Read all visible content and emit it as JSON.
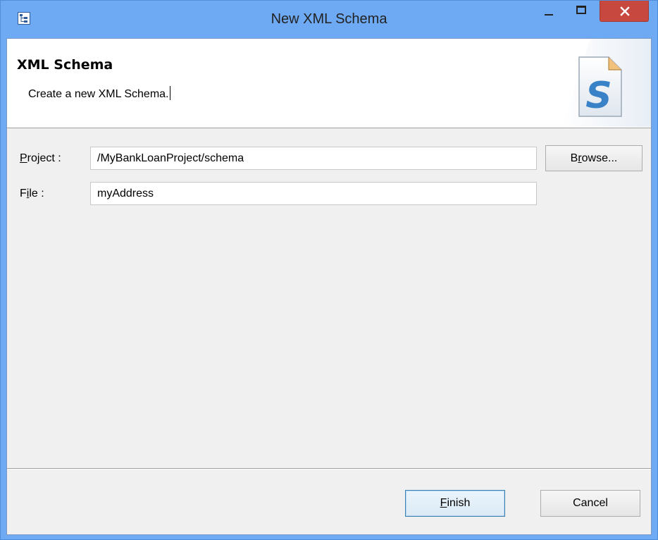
{
  "window": {
    "title": "New XML Schema"
  },
  "banner": {
    "title": "XML Schema",
    "description": "Create a new XML Schema."
  },
  "form": {
    "project_label_mnemonic": "P",
    "project_label_rest": "roject :",
    "project_value": "/MyBankLoanProject/schema",
    "browse_label_pre": "B",
    "browse_label_mnemonic": "r",
    "browse_label_post": "owse...",
    "file_label_pre": "F",
    "file_label_mnemonic": "i",
    "file_label_post": "le :",
    "file_value": "myAddress"
  },
  "footer": {
    "finish_label_mnemonic": "F",
    "finish_label_rest": "inish",
    "cancel_label": "Cancel"
  },
  "colors": {
    "titlebar": "#6eaaf4",
    "close_button": "#c7483e",
    "dialog_background": "#f0f0f0"
  },
  "icons": {
    "app": "tree-icon",
    "banner": "xml-schema-file-icon"
  }
}
